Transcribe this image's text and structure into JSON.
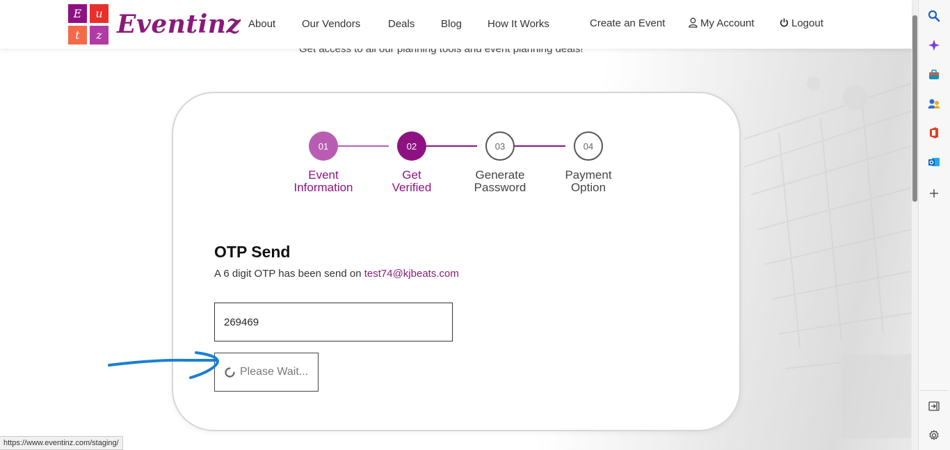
{
  "header": {
    "logo_letters": [
      "E",
      "u",
      "t",
      "z"
    ],
    "logo_word": "Eventinz",
    "nav": [
      "About",
      "Our Vendors",
      "Deals",
      "Blog",
      "How It Works"
    ],
    "create_event": "Create an Event",
    "my_account": "My Account",
    "logout": "Logout"
  },
  "subtitle": "Get access to all our planning tools and event planning deals!",
  "steps": [
    {
      "num": "01",
      "line1": "Event",
      "line2": "Information",
      "state": "done"
    },
    {
      "num": "02",
      "line1": "Get",
      "line2": "Verified",
      "state": "active"
    },
    {
      "num": "03",
      "line1": "Generate",
      "line2": "Password",
      "state": "pending"
    },
    {
      "num": "04",
      "line1": "Payment",
      "line2": "Option",
      "state": "pending"
    }
  ],
  "otp": {
    "title": "OTP Send",
    "message": "A 6 digit OTP has been send on",
    "email": "test74@kjbeats.com",
    "value": "269469",
    "button_label": "Please Wait..."
  },
  "status_url": "https://www.eventinz.com/staging/",
  "colors": {
    "brand_purple": "#8a1a7a",
    "step_done": "#b95db3",
    "step_active": "#8e1182",
    "annotation_blue": "#1b7fd4"
  },
  "sidebar_icons": [
    "search-icon",
    "copilot-icon",
    "shopping-icon",
    "people-icon",
    "office-icon",
    "outlook-icon",
    "add-icon",
    "split-screen-icon",
    "settings-icon"
  ]
}
